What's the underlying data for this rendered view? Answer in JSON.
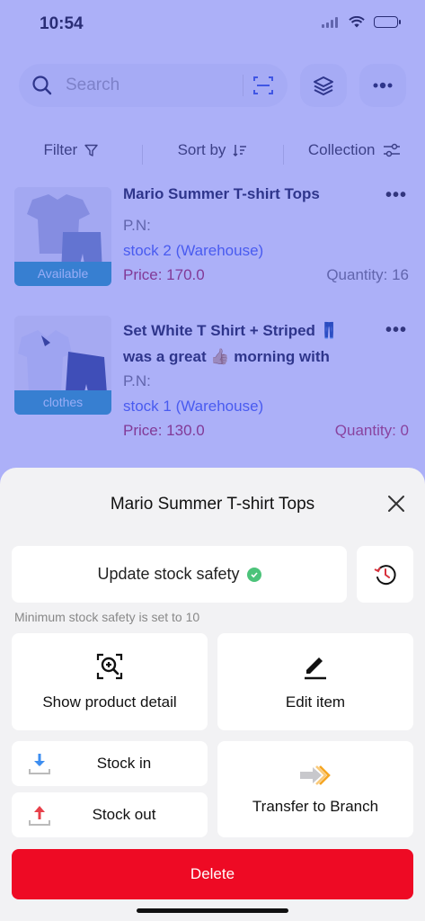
{
  "status_bar": {
    "time": "10:54"
  },
  "search": {
    "placeholder": "Search"
  },
  "filters": {
    "filter_label": "Filter",
    "sort_label": "Sort by",
    "collection_label": "Collection"
  },
  "products": [
    {
      "title": "Mario Summer T-shirt Tops",
      "badge": "Available",
      "pn_label": "P.N:",
      "location": "stock 2 (Warehouse)",
      "price": "Price: 170.0",
      "quantity": "Quantity: 16"
    },
    {
      "title": "Set White T Shirt + Striped 👖 was a great 👍🏼 morning with",
      "badge": "clothes",
      "pn_label": "P.N:",
      "location": "stock 1 (Warehouse)",
      "price": "Price: 130.0",
      "quantity": "Quantity: 0"
    }
  ],
  "sheet": {
    "title": "Mario Summer T-shirt Tops",
    "update_safety": "Update stock safety",
    "min_note": "Minimum stock safety is set to 10",
    "show_detail": "Show product detail",
    "edit_item": "Edit item",
    "stock_in": "Stock in",
    "stock_out": "Stock out",
    "transfer": "Transfer to Branch",
    "delete": "Delete"
  },
  "colors": {
    "accent_blue": "#4b65f0",
    "price": "#b2294f",
    "delete": "#ee0a24",
    "check_green": "#4cc37a",
    "overlay": "#5a64f2"
  }
}
